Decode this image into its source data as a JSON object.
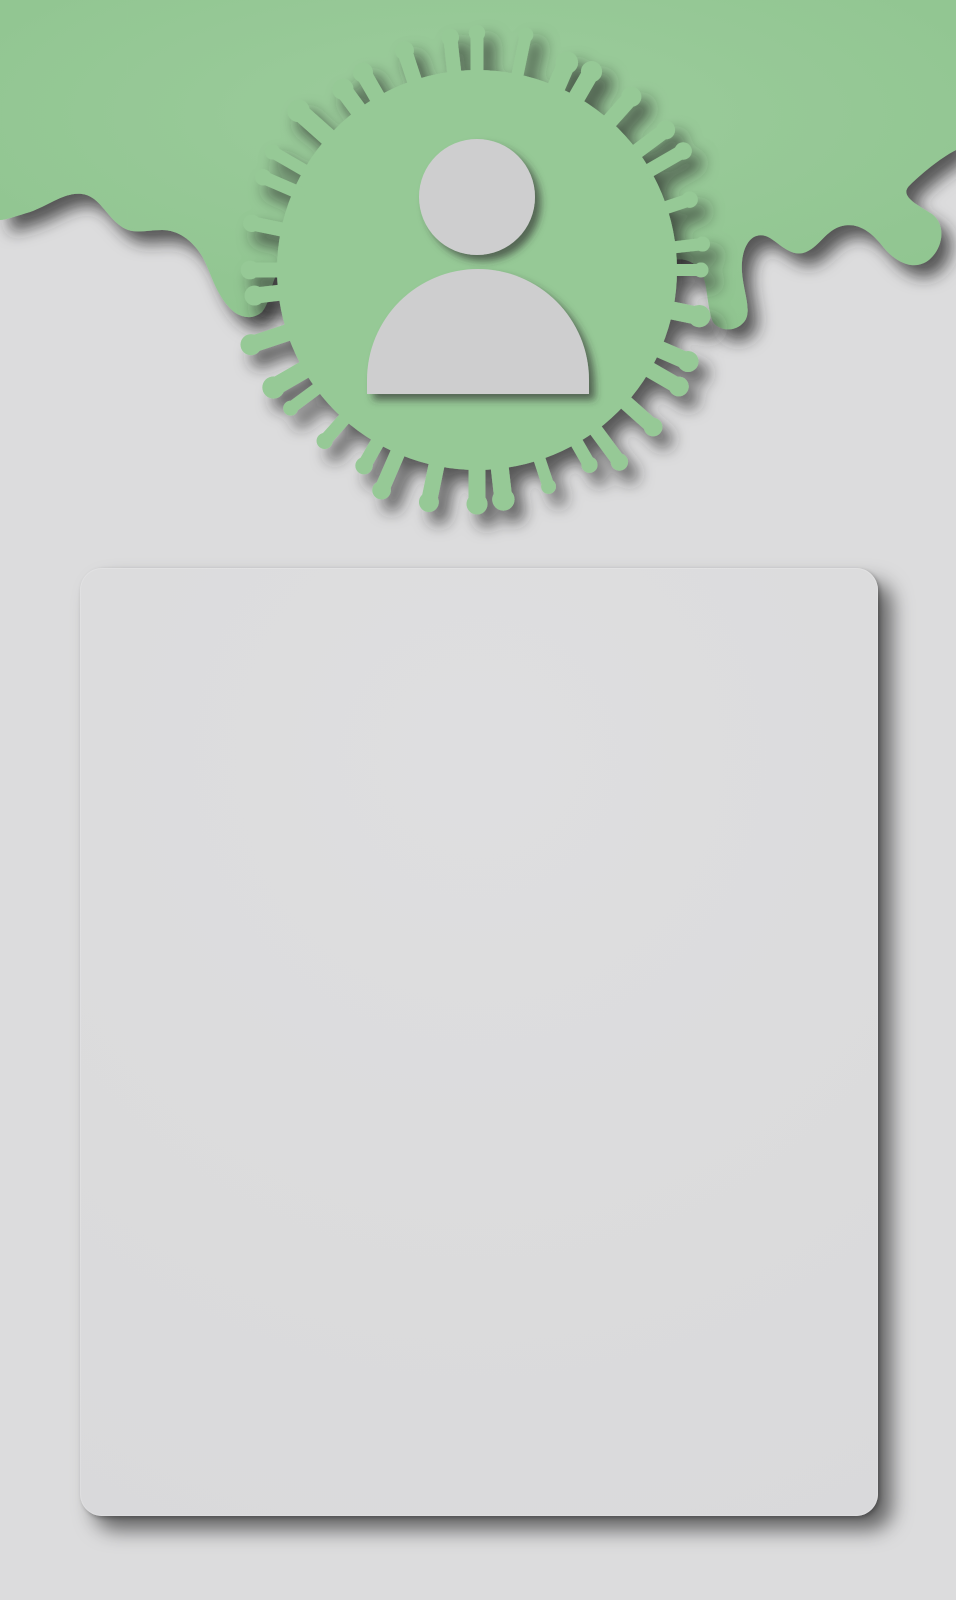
{
  "screen": {
    "name": "profile-screen"
  },
  "header": {
    "background_color": "#96c996",
    "shadow_color": "#3b3b3b"
  },
  "avatar": {
    "icon": "user-icon",
    "badge_color": "#96c996",
    "icon_color": "#cececf"
  },
  "card": {
    "background_color": "#dcdcdd"
  }
}
